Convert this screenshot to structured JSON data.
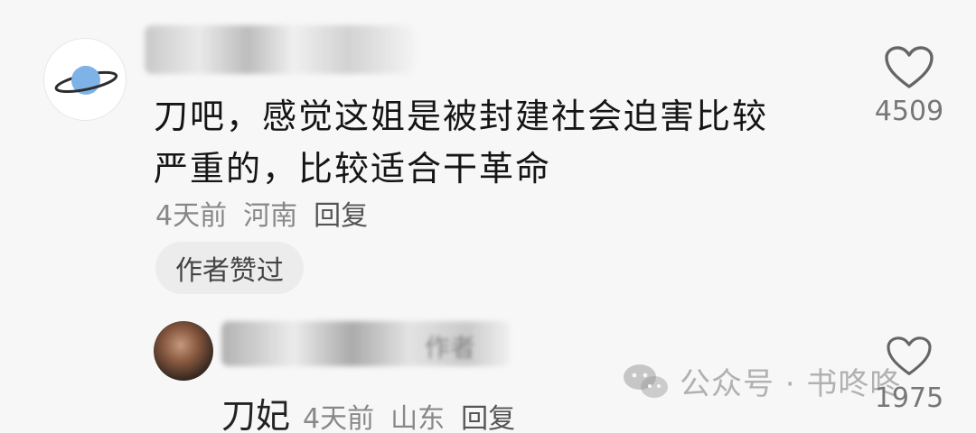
{
  "comment": {
    "text_line1": "刀吧，感觉这姐是被封建社会迫害比较",
    "text_line2": "严重的，比较适合干革命",
    "time": "4天前",
    "location": "河南",
    "reply_label": "回复",
    "author_liked_badge": "作者赞过",
    "like_count": "4509"
  },
  "reply_comment": {
    "author_tag": "作者",
    "name": "刀妃",
    "time": "4天前",
    "location": "山东",
    "reply_label": "回复",
    "like_count": "1975"
  },
  "watermark": {
    "text": "公众号 · 书咚咚",
    "icon": "wechat-icon"
  },
  "icons": {
    "avatar_main": "planet-icon",
    "like": "heart-icon"
  },
  "colors": {
    "background": "#f7f7f7",
    "text_primary": "#151515",
    "text_secondary": "#888888",
    "badge_bg": "#ececec",
    "planet_blue": "#7fb2e6"
  }
}
